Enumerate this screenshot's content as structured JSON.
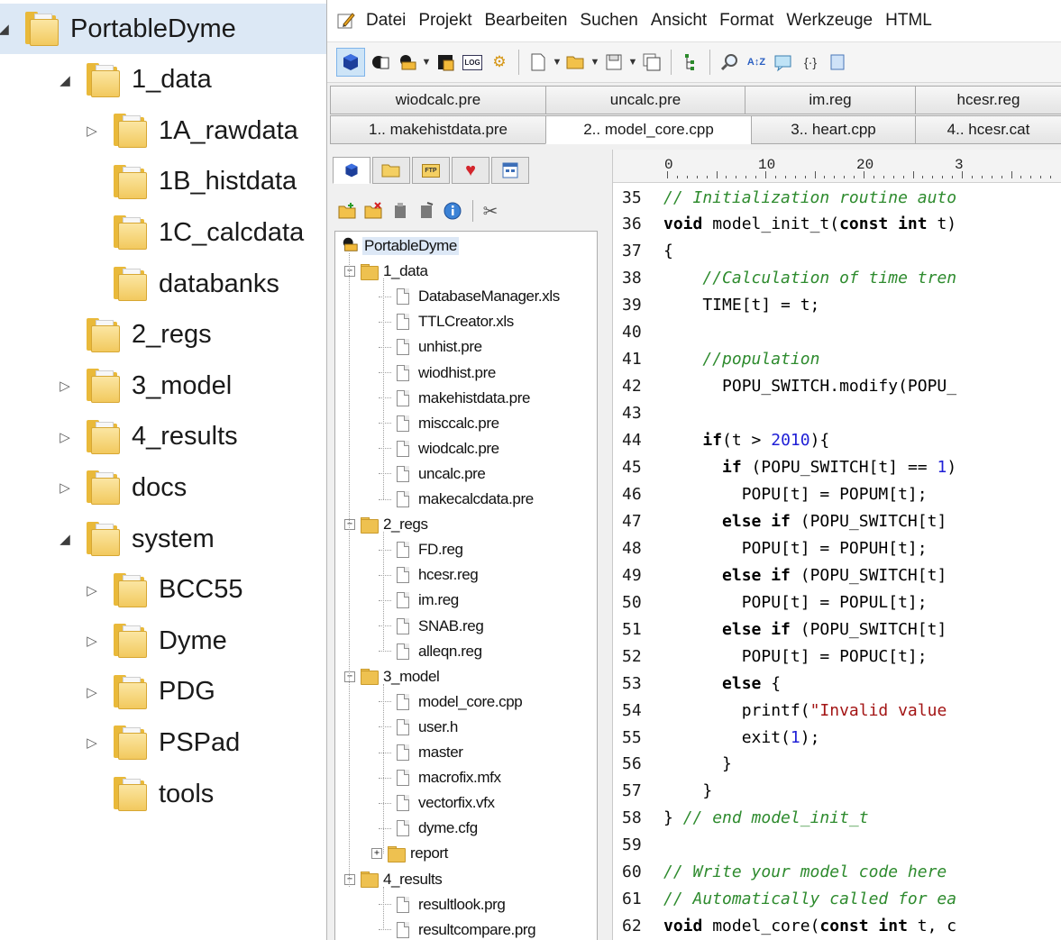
{
  "explorer": {
    "items": [
      {
        "label": "PortableDyme",
        "toggle": "open",
        "level": 0,
        "selected": true
      },
      {
        "label": "1_data",
        "toggle": "open",
        "level": 1
      },
      {
        "label": "1A_rawdata",
        "toggle": "closed",
        "level": 2
      },
      {
        "label": "1B_histdata",
        "toggle": "none",
        "level": 2
      },
      {
        "label": "1C_calcdata",
        "toggle": "none",
        "level": 2
      },
      {
        "label": "databanks",
        "toggle": "none",
        "level": 2
      },
      {
        "label": "2_regs",
        "toggle": "none",
        "level": 1
      },
      {
        "label": "3_model",
        "toggle": "closed",
        "level": 1
      },
      {
        "label": "4_results",
        "toggle": "closed",
        "level": 1
      },
      {
        "label": "docs",
        "toggle": "closed",
        "level": 1
      },
      {
        "label": "system",
        "toggle": "open",
        "level": 1
      },
      {
        "label": "BCC55",
        "toggle": "closed",
        "level": 2
      },
      {
        "label": "Dyme",
        "toggle": "closed",
        "level": 2
      },
      {
        "label": "PDG",
        "toggle": "closed",
        "level": 2
      },
      {
        "label": "PSPad",
        "toggle": "closed",
        "level": 2
      },
      {
        "label": "tools",
        "toggle": "none",
        "level": 2
      }
    ],
    "glyphs": {
      "open": "◢",
      "closed": "▷"
    }
  },
  "editor": {
    "menu": [
      "Datei",
      "Projekt",
      "Bearbeiten",
      "Suchen",
      "Ansicht",
      "Format",
      "Werkzeuge",
      "HTML"
    ],
    "tabs_row1": [
      {
        "label": "wiodcalc.pre",
        "active": false
      },
      {
        "label": "uncalc.pre",
        "active": false
      },
      {
        "label": "im.reg",
        "active": false
      },
      {
        "label": "hcesr.reg",
        "active": false
      }
    ],
    "tabs_row2": [
      {
        "label": "1.. makehistdata.pre",
        "active": false
      },
      {
        "label": "2.. model_core.cpp",
        "active": true
      },
      {
        "label": "3.. heart.cpp",
        "active": false
      },
      {
        "label": "4.. hcesr.cat",
        "active": false
      }
    ],
    "toolbar": {
      "log_label": "LOG",
      "icons": [
        "project-icon",
        "open-project-icon",
        "save-project-icon",
        "compile-icon",
        "log-icon",
        "settings-icon",
        "new-file-icon",
        "open-file-icon",
        "save-file-icon",
        "save-all-icon",
        "tree-icon",
        "find-icon",
        "replace-icon",
        "preview-icon",
        "code-icon"
      ]
    },
    "panel": {
      "tabs": [
        "project-tab-icon",
        "folder-tab-icon",
        "ftp-tab-icon",
        "favorites-tab-icon",
        "windows-tab-icon"
      ],
      "ftp_label": "FTP",
      "tools": [
        "add-file-icon",
        "remove-file-icon",
        "file-properties-icon",
        "file-edit-icon",
        "info-icon",
        "project-settings-icon"
      ],
      "tree": [
        {
          "label": "PortableDyme",
          "type": "root"
        },
        {
          "label": "1_data",
          "type": "folder",
          "box": "−"
        },
        {
          "label": "DatabaseManager.xls",
          "type": "file"
        },
        {
          "label": "TTLCreator.xls",
          "type": "file"
        },
        {
          "label": "unhist.pre",
          "type": "file"
        },
        {
          "label": "wiodhist.pre",
          "type": "file"
        },
        {
          "label": "makehistdata.pre",
          "type": "file"
        },
        {
          "label": "misccalc.pre",
          "type": "file"
        },
        {
          "label": "wiodcalc.pre",
          "type": "file"
        },
        {
          "label": "uncalc.pre",
          "type": "file"
        },
        {
          "label": "makecalcdata.pre",
          "type": "file"
        },
        {
          "label": "2_regs",
          "type": "folder",
          "box": "−"
        },
        {
          "label": "FD.reg",
          "type": "file"
        },
        {
          "label": "hcesr.reg",
          "type": "file"
        },
        {
          "label": "im.reg",
          "type": "file"
        },
        {
          "label": "SNAB.reg",
          "type": "file"
        },
        {
          "label": "alleqn.reg",
          "type": "file"
        },
        {
          "label": "3_model",
          "type": "folder",
          "box": "−"
        },
        {
          "label": "model_core.cpp",
          "type": "file"
        },
        {
          "label": "user.h",
          "type": "file"
        },
        {
          "label": "master",
          "type": "file"
        },
        {
          "label": "macrofix.mfx",
          "type": "file"
        },
        {
          "label": "vectorfix.vfx",
          "type": "file"
        },
        {
          "label": "dyme.cfg",
          "type": "file"
        },
        {
          "label": "report",
          "type": "subfolder",
          "box": "+"
        },
        {
          "label": "4_results",
          "type": "folder",
          "box": "−"
        },
        {
          "label": "resultlook.prg",
          "type": "file"
        },
        {
          "label": "resultcompare.prg",
          "type": "file"
        }
      ]
    },
    "ruler": {
      "start_label": "0",
      "labels": [
        "10",
        "20",
        "3"
      ]
    },
    "code": [
      {
        "n": "35",
        "parts": [
          {
            "t": "// Initialization routine auto",
            "c": "com"
          }
        ]
      },
      {
        "n": "36",
        "parts": [
          {
            "t": "void",
            "c": "kw"
          },
          {
            "t": " model_init_t(",
            "c": ""
          },
          {
            "t": "const int",
            "c": "kw"
          },
          {
            "t": " t)",
            "c": ""
          }
        ]
      },
      {
        "n": "37",
        "parts": [
          {
            "t": "{",
            "c": ""
          }
        ]
      },
      {
        "n": "38",
        "parts": [
          {
            "t": "    ",
            "c": ""
          },
          {
            "t": "//Calculation of time tren",
            "c": "com"
          }
        ]
      },
      {
        "n": "39",
        "parts": [
          {
            "t": "    TIME[t] = t;",
            "c": ""
          }
        ]
      },
      {
        "n": "40",
        "parts": []
      },
      {
        "n": "41",
        "parts": [
          {
            "t": "    ",
            "c": ""
          },
          {
            "t": "//population",
            "c": "com"
          }
        ]
      },
      {
        "n": "42",
        "parts": [
          {
            "t": "      POPU_SWITCH.modify(POPU_",
            "c": ""
          }
        ]
      },
      {
        "n": "43",
        "parts": []
      },
      {
        "n": "44",
        "parts": [
          {
            "t": "    ",
            "c": ""
          },
          {
            "t": "if",
            "c": "kw"
          },
          {
            "t": "(t > ",
            "c": ""
          },
          {
            "t": "2010",
            "c": "num"
          },
          {
            "t": "){",
            "c": ""
          }
        ]
      },
      {
        "n": "45",
        "parts": [
          {
            "t": "      ",
            "c": ""
          },
          {
            "t": "if",
            "c": "kw"
          },
          {
            "t": " (POPU_SWITCH[t] == ",
            "c": ""
          },
          {
            "t": "1",
            "c": "num"
          },
          {
            "t": ")",
            "c": ""
          }
        ]
      },
      {
        "n": "46",
        "parts": [
          {
            "t": "        POPU[t] = POPUM[t];",
            "c": ""
          }
        ]
      },
      {
        "n": "47",
        "parts": [
          {
            "t": "      ",
            "c": ""
          },
          {
            "t": "else if",
            "c": "kw"
          },
          {
            "t": " (POPU_SWITCH[t]",
            "c": ""
          }
        ]
      },
      {
        "n": "48",
        "parts": [
          {
            "t": "        POPU[t] = POPUH[t];",
            "c": ""
          }
        ]
      },
      {
        "n": "49",
        "parts": [
          {
            "t": "      ",
            "c": ""
          },
          {
            "t": "else if",
            "c": "kw"
          },
          {
            "t": " (POPU_SWITCH[t]",
            "c": ""
          }
        ]
      },
      {
        "n": "50",
        "parts": [
          {
            "t": "        POPU[t] = POPUL[t];",
            "c": ""
          }
        ]
      },
      {
        "n": "51",
        "parts": [
          {
            "t": "      ",
            "c": ""
          },
          {
            "t": "else if",
            "c": "kw"
          },
          {
            "t": " (POPU_SWITCH[t]",
            "c": ""
          }
        ]
      },
      {
        "n": "52",
        "parts": [
          {
            "t": "        POPU[t] = POPUC[t];",
            "c": ""
          }
        ]
      },
      {
        "n": "53",
        "parts": [
          {
            "t": "      ",
            "c": ""
          },
          {
            "t": "else",
            "c": "kw"
          },
          {
            "t": " {",
            "c": ""
          }
        ]
      },
      {
        "n": "54",
        "parts": [
          {
            "t": "        printf(",
            "c": ""
          },
          {
            "t": "\"Invalid value",
            "c": "str"
          }
        ]
      },
      {
        "n": "55",
        "parts": [
          {
            "t": "        exit(",
            "c": ""
          },
          {
            "t": "1",
            "c": "num"
          },
          {
            "t": ");",
            "c": ""
          }
        ]
      },
      {
        "n": "56",
        "parts": [
          {
            "t": "      }",
            "c": ""
          }
        ]
      },
      {
        "n": "57",
        "parts": [
          {
            "t": "    }",
            "c": ""
          }
        ]
      },
      {
        "n": "58",
        "parts": [
          {
            "t": "} ",
            "c": ""
          },
          {
            "t": "// end model_init_t",
            "c": "com"
          }
        ]
      },
      {
        "n": "59",
        "parts": []
      },
      {
        "n": "60",
        "parts": [
          {
            "t": "// Write your model code here",
            "c": "com"
          }
        ]
      },
      {
        "n": "61",
        "parts": [
          {
            "t": "// Automatically called for ea",
            "c": "com"
          }
        ]
      },
      {
        "n": "62",
        "parts": [
          {
            "t": "void",
            "c": "kw"
          },
          {
            "t": " model_core(",
            "c": ""
          },
          {
            "t": "const int",
            "c": "kw"
          },
          {
            "t": " t, c",
            "c": ""
          }
        ]
      }
    ]
  }
}
